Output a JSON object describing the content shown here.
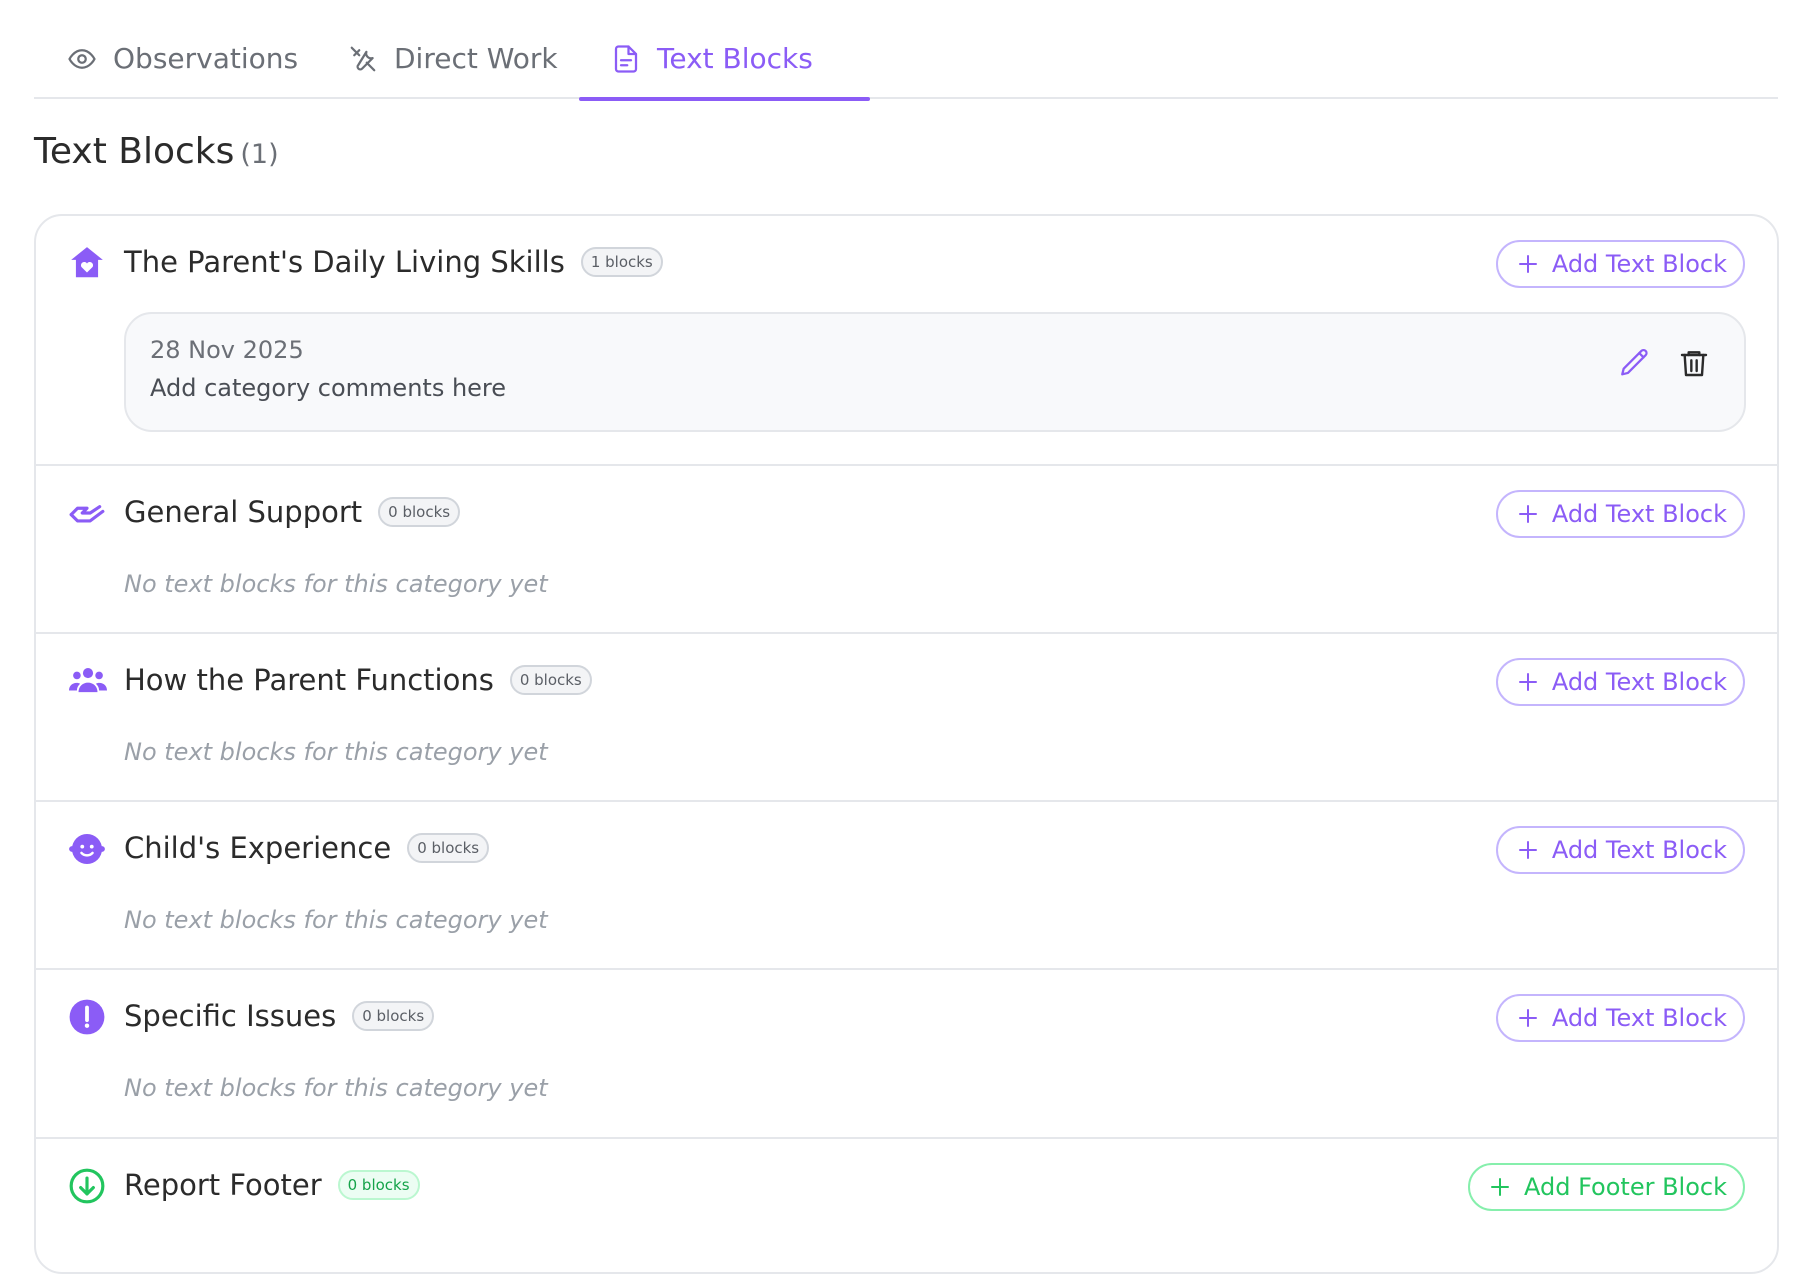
{
  "tabs": [
    {
      "label": "Observations",
      "icon": "eye-icon",
      "active": false
    },
    {
      "label": "Direct Work",
      "icon": "tools-icon",
      "active": false
    },
    {
      "label": "Text Blocks",
      "icon": "document-icon",
      "active": true
    }
  ],
  "heading": {
    "title": "Text Blocks",
    "count": "(1)"
  },
  "accent_color": "#8b5cf6",
  "footer_color": "#22c55e",
  "sections": [
    {
      "title": "The Parent's Daily Living Skills",
      "icon": "home-heart-icon",
      "badge": "1 blocks",
      "button": "Add Text Block",
      "blocks": [
        {
          "date": "28 Nov 2025",
          "text": "Add category comments here"
        }
      ]
    },
    {
      "title": "General Support",
      "icon": "helping-hand-icon",
      "badge": "0 blocks",
      "button": "Add Text Block",
      "empty_text": "No text blocks for this category yet"
    },
    {
      "title": "How the Parent Functions",
      "icon": "users-icon",
      "badge": "0 blocks",
      "button": "Add Text Block",
      "empty_text": "No text blocks for this category yet"
    },
    {
      "title": "Child's Experience",
      "icon": "child-face-icon",
      "badge": "0 blocks",
      "button": "Add Text Block",
      "empty_text": "No text blocks for this category yet"
    },
    {
      "title": "Specific Issues",
      "icon": "exclamation-circle-icon",
      "badge": "0 blocks",
      "button": "Add Text Block",
      "empty_text": "No text blocks for this category yet"
    },
    {
      "title": "Report Footer",
      "icon": "arrow-down-circle-icon",
      "badge": "0 blocks",
      "button": "Add Footer Block"
    }
  ]
}
